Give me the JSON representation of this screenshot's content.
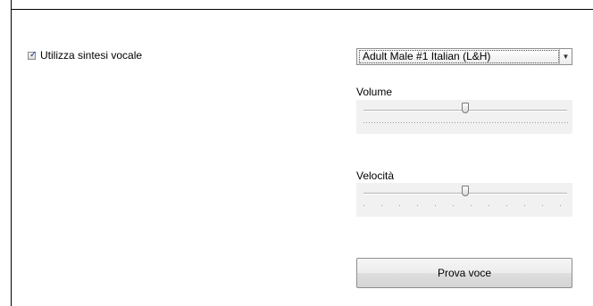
{
  "tts": {
    "enabled": true,
    "checkbox_label": "Utilizza sintesi vocale"
  },
  "voice": {
    "selected": "Adult Male #1 Italian (L&H)"
  },
  "volume": {
    "label": "Volume",
    "value_fraction": 0.5
  },
  "speed": {
    "label": "Velocità",
    "value_fraction": 0.5
  },
  "test_button": {
    "label": "Prova voce"
  },
  "icons": {
    "checkbox_mark": "check-icon",
    "dropdown_arrow": "chevron-down-icon"
  }
}
